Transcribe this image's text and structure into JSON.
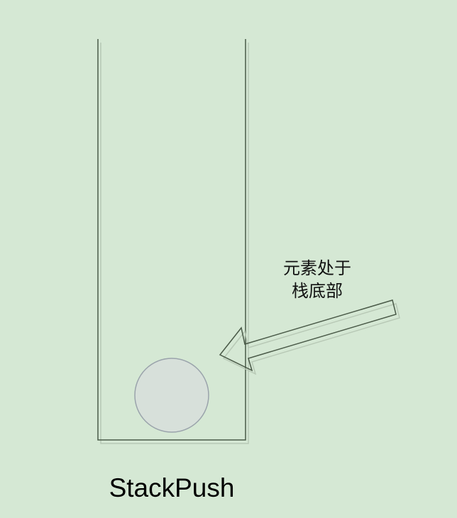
{
  "diagram": {
    "annotation": {
      "line1": "元素处于",
      "line2": "栈底部"
    },
    "caption": "StackPush"
  },
  "colors": {
    "background": "#d5e8d4",
    "stack_outline": "#4a5a48",
    "element_fill": "#d7e0da",
    "element_stroke": "#9aa3ab",
    "arrow_stroke": "#4a5a48"
  }
}
